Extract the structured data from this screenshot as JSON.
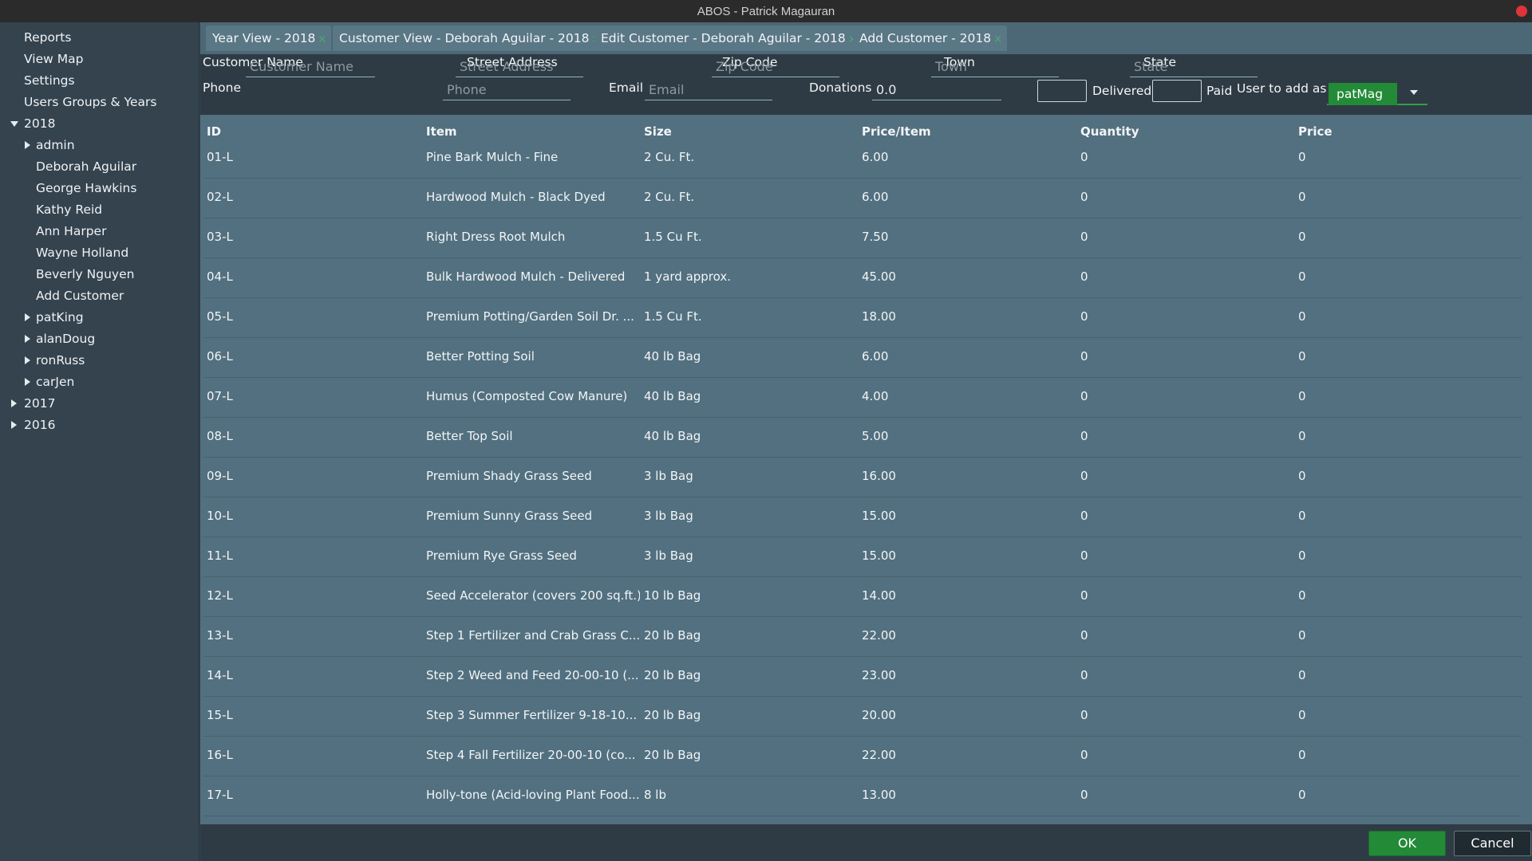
{
  "window": {
    "title": "ABOS - Patrick Magauran"
  },
  "sidebar": {
    "items": [
      {
        "label": "Reports",
        "level": 0,
        "arrow": "none"
      },
      {
        "label": "View Map",
        "level": 0,
        "arrow": "none"
      },
      {
        "label": "Settings",
        "level": 0,
        "arrow": "none"
      },
      {
        "label": "Users Groups & Years",
        "level": 0,
        "arrow": "none"
      },
      {
        "label": "2018",
        "level": 0,
        "arrow": "down"
      },
      {
        "label": "admin",
        "level": 1,
        "arrow": "right"
      },
      {
        "label": "Deborah Aguilar",
        "level": 2,
        "arrow": "none"
      },
      {
        "label": "George Hawkins",
        "level": 2,
        "arrow": "none"
      },
      {
        "label": "Kathy Reid",
        "level": 2,
        "arrow": "none"
      },
      {
        "label": "Ann Harper",
        "level": 2,
        "arrow": "none"
      },
      {
        "label": "Wayne Holland",
        "level": 2,
        "arrow": "none"
      },
      {
        "label": "Beverly Nguyen",
        "level": 2,
        "arrow": "none"
      },
      {
        "label": "Add Customer",
        "level": 2,
        "arrow": "none"
      },
      {
        "label": "patKing",
        "level": 1,
        "arrow": "right"
      },
      {
        "label": "alanDoug",
        "level": 1,
        "arrow": "right"
      },
      {
        "label": "ronRuss",
        "level": 1,
        "arrow": "right"
      },
      {
        "label": "carJen",
        "level": 1,
        "arrow": "right"
      },
      {
        "label": "2017",
        "level": 0,
        "arrow": "right"
      },
      {
        "label": "2016",
        "level": 0,
        "arrow": "right"
      }
    ]
  },
  "tabs": [
    {
      "label": "Year View - 2018"
    },
    {
      "label": "Customer View - Deborah Aguilar - 2018"
    },
    {
      "label": "Edit Customer - Deborah Aguilar - 2018"
    },
    {
      "label": "Add Customer - 2018"
    }
  ],
  "tab_close_glyph": "×",
  "form": {
    "customer_name_label": "Customer Name",
    "customer_name_placeholder": "Customer Name",
    "street_label": "Street Address",
    "street_placeholder": "Street Address",
    "zip_label": "Zip Code",
    "zip_placeholder": "Zip Code",
    "town_label": "Town",
    "town_placeholder": "Town",
    "state_label": "State",
    "state_placeholder": "State",
    "phone_label": "Phone",
    "phone_placeholder": "Phone",
    "email_label": "Email",
    "email_placeholder": "Email",
    "donations_label": "Donations",
    "donations_value": "0.0",
    "delivered_label": "Delivered",
    "paid_label": "Paid",
    "user_label": "User to add as:",
    "user_value": "patMag"
  },
  "table": {
    "columns": [
      "ID",
      "Item",
      "Size",
      "Price/Item",
      "Quantity",
      "Price"
    ],
    "rows": [
      [
        "01-L",
        "Pine Bark Mulch - Fine",
        "2 Cu. Ft.",
        "6.00",
        "0",
        "0"
      ],
      [
        "02-L",
        "Hardwood Mulch - Black Dyed",
        "2 Cu. Ft.",
        "6.00",
        "0",
        "0"
      ],
      [
        "03-L",
        "Right Dress Root Mulch",
        "1.5 Cu Ft.",
        "7.50",
        "0",
        "0"
      ],
      [
        "04-L",
        "Bulk Hardwood Mulch - Delivered",
        "1 yard approx.",
        "45.00",
        "0",
        "0"
      ],
      [
        "05-L",
        "Premium Potting/Garden Soil  Dr. ...",
        "1.5 Cu Ft.",
        "18.00",
        "0",
        "0"
      ],
      [
        "06-L",
        "Better Potting Soil",
        "40 lb Bag",
        "6.00",
        "0",
        "0"
      ],
      [
        "07-L",
        "Humus (Composted Cow Manure)",
        "40 lb Bag",
        "4.00",
        "0",
        "0"
      ],
      [
        "08-L",
        "Better Top Soil",
        "40 lb Bag",
        "5.00",
        "0",
        "0"
      ],
      [
        "09-L",
        "Premium Shady Grass Seed",
        "3 lb Bag",
        "16.00",
        "0",
        "0"
      ],
      [
        "10-L",
        "Premium Sunny Grass Seed",
        "3 lb Bag",
        "15.00",
        "0",
        "0"
      ],
      [
        "11-L",
        "Premium Rye Grass Seed",
        "3 lb Bag",
        "15.00",
        "0",
        "0"
      ],
      [
        "12-L",
        "Seed Accelerator (covers 200 sq.ft.)",
        "10 lb Bag",
        "14.00",
        "0",
        "0"
      ],
      [
        "13-L",
        "Step 1 Fertilizer and Crab Grass C...",
        "20 lb Bag",
        "22.00",
        "0",
        "0"
      ],
      [
        "14-L",
        "Step 2 Weed and Feed 20-00-10 (...",
        "20 lb Bag",
        "23.00",
        "0",
        "0"
      ],
      [
        "15-L",
        "Step 3 Summer Fertilizer 9-18-10...",
        "20 lb Bag",
        "20.00",
        "0",
        "0"
      ],
      [
        "16-L",
        "Step 4 Fall Fertilizer 20-00-10 (co...",
        "20 lb Bag",
        "22.00",
        "0",
        "0"
      ],
      [
        "17-L",
        "Holly-tone (Acid-loving Plant Food...",
        "8 lb",
        "13.00",
        "0",
        "0"
      ]
    ]
  },
  "footer": {
    "ok_label": "OK",
    "cancel_label": "Cancel"
  },
  "colors": {
    "sidebar_bg": "#34434e",
    "main_bg": "#52707f",
    "form_bg": "#2e3b44",
    "ok_green": "#238a38",
    "close_red": "#e0343a",
    "tab_close_green": "#3fb36a"
  }
}
